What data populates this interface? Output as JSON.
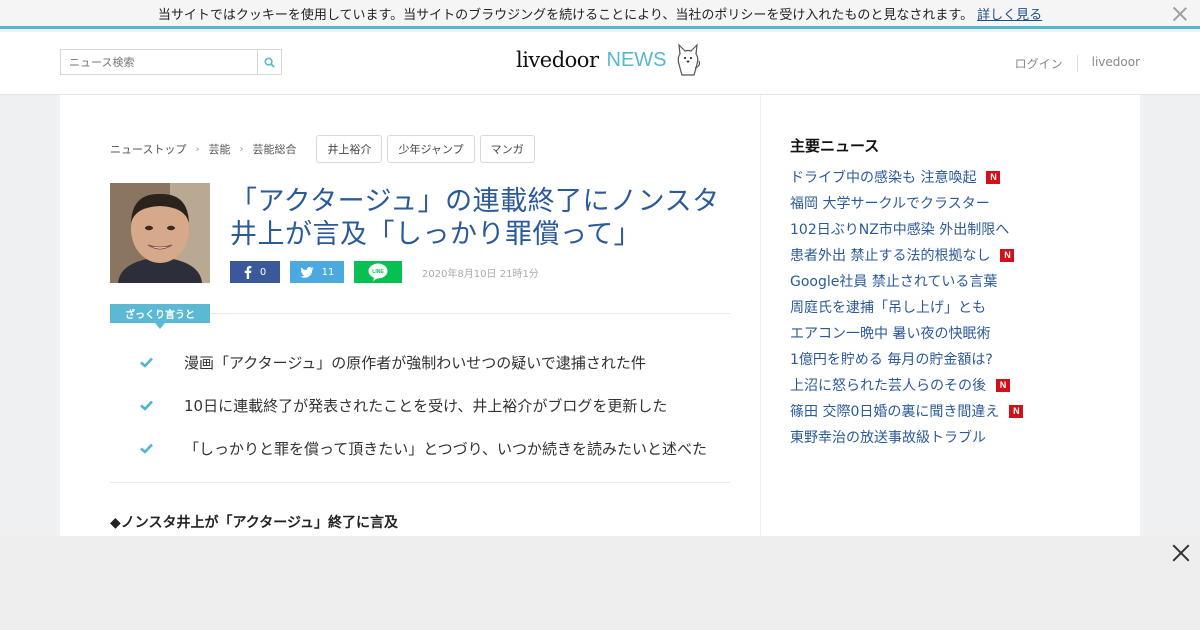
{
  "cookie": {
    "text": "当サイトではクッキーを使用しています。当サイトのブラウジングを続けることにより、当社のポリシーを受け入れたものと見なされます。",
    "link": "詳しく見る"
  },
  "header": {
    "search_placeholder": "ニュース検索",
    "logo_main": "livedoor",
    "logo_news": "NEWS",
    "login": "ログイン",
    "livedoor_link": "livedoor"
  },
  "breadcrumb": [
    "ニューストップ",
    "芸能",
    "芸能総合"
  ],
  "tags": [
    "井上裕介",
    "少年ジャンプ",
    "マンガ"
  ],
  "article": {
    "title_line1": "「アクタージュ」の連載終了にノンスタ",
    "title_line2": "井上が言及「しっかり罪償って」",
    "fb_count": "0",
    "tw_count": "11",
    "date": "2020年8月10日 21時1分",
    "summary_label": "ざっくり言うと",
    "summary": [
      "漫画「アクタージュ」の原作者が強制わいせつの疑いで逮捕された件",
      "10日に連載終了が発表されたことを受け、井上裕介がブログを更新した",
      "「しっかりと罪を償って頂きたい」とつづり、いつか続きを読みたいと述べた"
    ],
    "subheading": "◆ノンスタ井上が「アクタージュ」終了に言及"
  },
  "side": {
    "title": "主要ニュース",
    "badge_label": "N",
    "items": [
      {
        "text": "ドライブ中の感染も 注意喚起",
        "new": true
      },
      {
        "text": "福岡 大学サークルでクラスター",
        "new": false
      },
      {
        "text": "102日ぶりNZ市中感染 外出制限へ",
        "new": false
      },
      {
        "text": "患者外出 禁止する法的根拠なし",
        "new": true
      },
      {
        "text": "Google社員 禁止されている言葉",
        "new": false
      },
      {
        "text": "周庭氏を逮捕「吊し上げ」とも",
        "new": false
      },
      {
        "text": "エアコン一晩中 暑い夜の快眠術",
        "new": false
      },
      {
        "text": "1億円を貯める 毎月の貯金額は?",
        "new": false
      },
      {
        "text": "上沼に怒られた芸人らのその後",
        "new": true
      },
      {
        "text": "篠田 交際0日婚の裏に聞き間違え",
        "new": true
      },
      {
        "text": "東野幸治の放送事故級トラブル",
        "new": false
      }
    ]
  },
  "colors": {
    "accent": "#58b7cf",
    "link": "#2b5a9a",
    "facebook": "#3b5998",
    "twitter": "#4aa9de",
    "line": "#06c152",
    "new_badge": "#d3101a"
  }
}
